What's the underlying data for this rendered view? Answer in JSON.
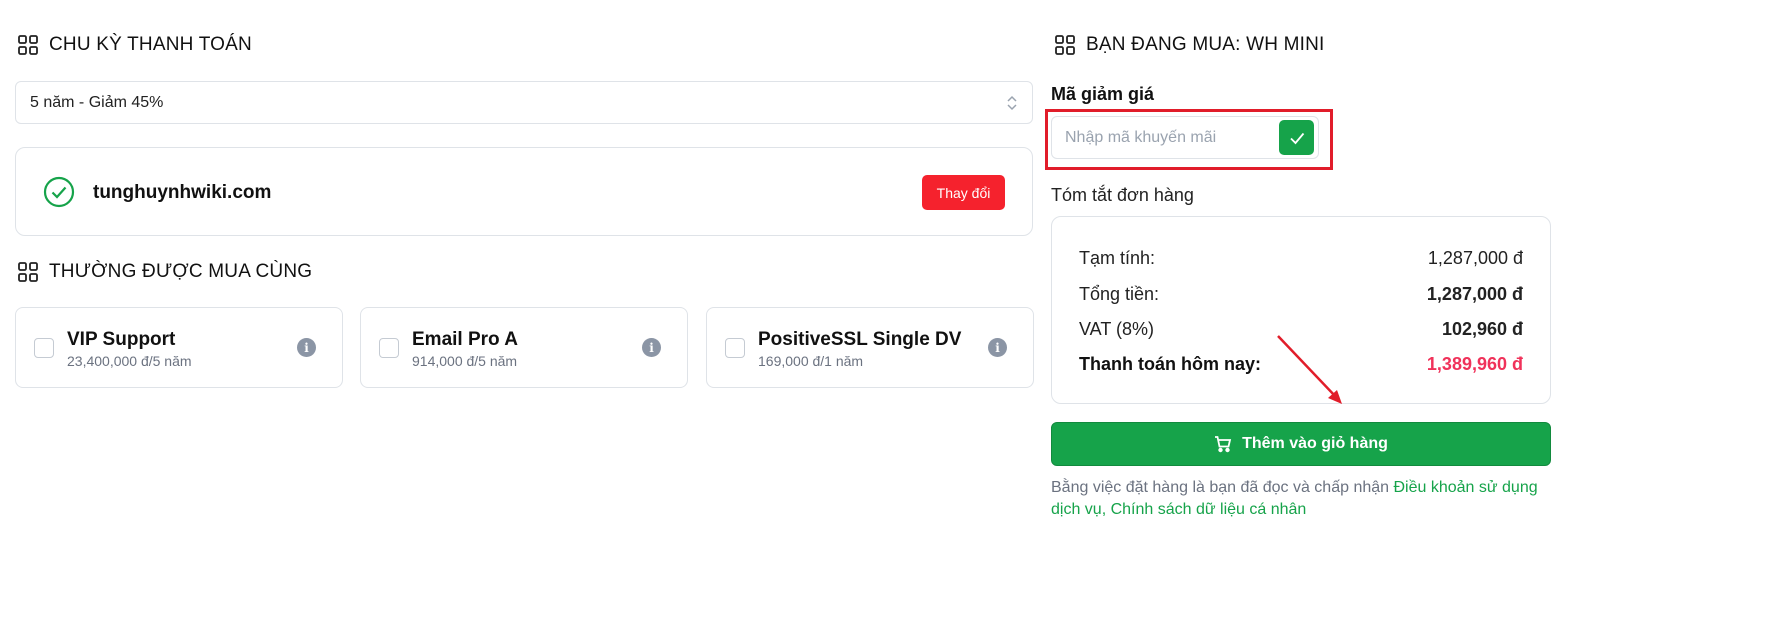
{
  "billing": {
    "title": "CHU KỲ THANH TOÁN",
    "selected_cycle": "5 năm - Giảm 45%"
  },
  "domain": {
    "name": "tunghuynhwiki.com",
    "change_label": "Thay đổi"
  },
  "addons": {
    "title": "THƯỜNG ĐƯỢC MUA CÙNG",
    "items": [
      {
        "name": "VIP Support",
        "price": "23,400,000 đ/5 năm"
      },
      {
        "name": "Email Pro A",
        "price": "914,000 đ/5 năm"
      },
      {
        "name": "PositiveSSL Single DV",
        "price": "169,000 đ/1 năm"
      }
    ]
  },
  "order": {
    "title": "BẠN ĐANG MUA: WH MINI",
    "coupon_label": "Mã giảm giá",
    "coupon_placeholder": "Nhập mã khuyến mãi",
    "summary_title": "Tóm tắt đơn hàng",
    "rows": [
      {
        "label": "Tạm tính:",
        "value": "1,287,000 đ"
      },
      {
        "label": "Tổng tiền:",
        "value": "1,287,000 đ"
      },
      {
        "label": "VAT (8%)",
        "value": "102,960 đ"
      },
      {
        "label": "Thanh toán hôm nay:",
        "value": "1,389,960 đ"
      }
    ],
    "cart_button": "Thêm vào giỏ hàng",
    "terms_text": "Bằng việc đặt hàng là bạn đã đọc và chấp nhận ",
    "terms_link1": "Điều khoản sử dụng dịch vụ",
    "terms_sep": ", ",
    "terms_link2": "Chính sách dữ liệu cá nhân"
  },
  "colors": {
    "accent_green": "#16a34a",
    "danger_red": "#f5222d",
    "total_pink": "#f0325a",
    "highlight_red": "#e11d2a"
  }
}
